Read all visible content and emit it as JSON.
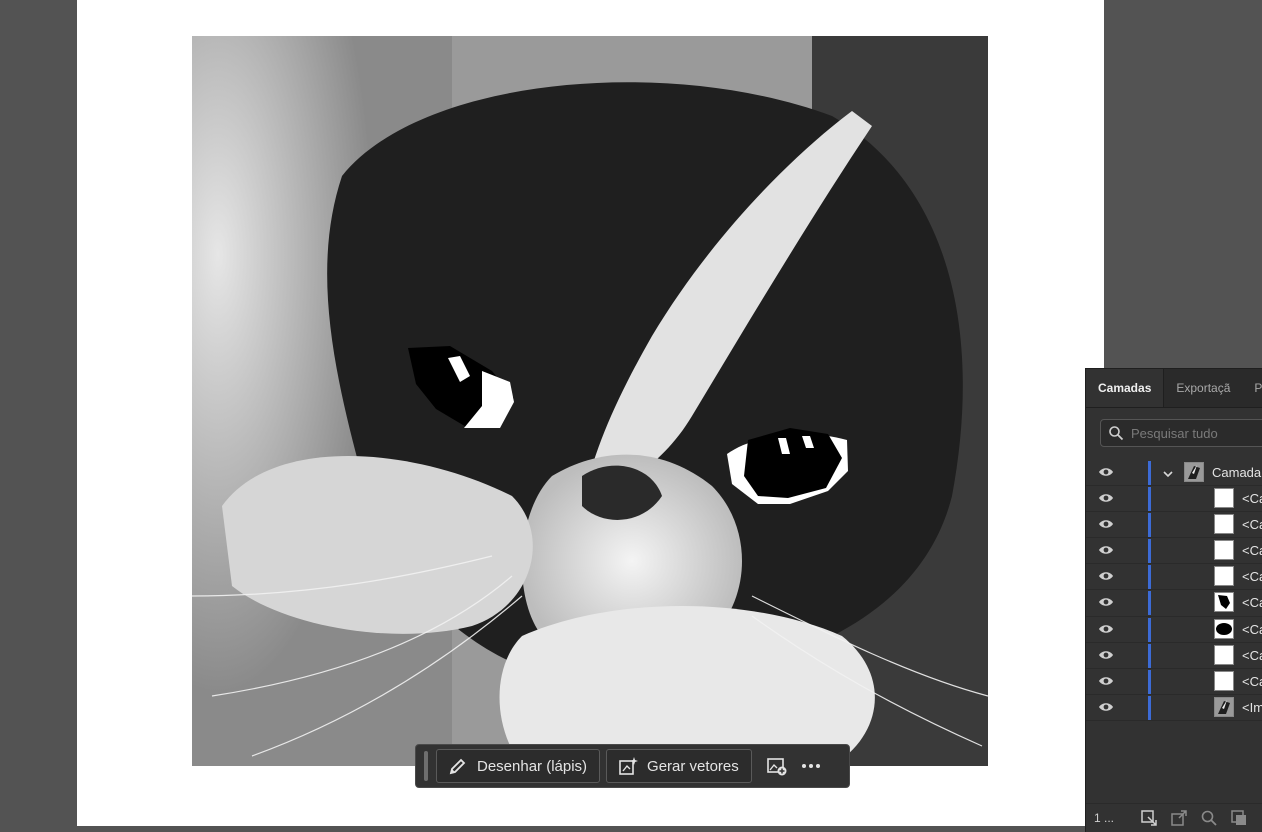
{
  "taskbar": {
    "draw_label": "Desenhar (lápis)",
    "vectors_label": "Gerar vetores"
  },
  "layers_panel": {
    "tabs": [
      "Camadas",
      "Exportaçã",
      "Pran"
    ],
    "search_placeholder": "Pesquisar tudo",
    "layer_name": "Camada",
    "items": [
      "<Ca",
      "<Ca",
      "<Ca",
      "<Ca",
      "<Ca",
      "<Ca",
      "<Ca",
      "<Ca",
      "<Im"
    ],
    "count": "1 ..."
  },
  "colors": {
    "accent": "#3c6bd6",
    "ui_dark": "#323232",
    "canvas": "#535353"
  }
}
